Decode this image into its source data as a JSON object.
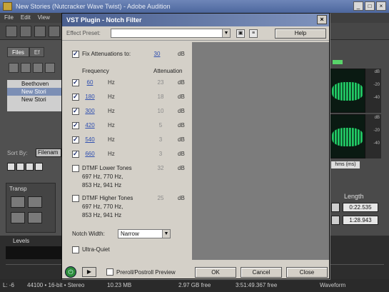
{
  "host": {
    "title": "New Stories (Nutcracker Wave Twist) - Adobe Audition",
    "menu": [
      "File",
      "Edit",
      "View"
    ],
    "window_buttons": [
      "_",
      "□",
      "×"
    ],
    "tabs": [
      "Files",
      "Ef"
    ],
    "files": [
      "Beethoven",
      "New Stori",
      "New Stori"
    ],
    "sort_label": "Sort By:",
    "sort_value": "Filenam",
    "transport_label": "Transp",
    "levels_label": "Levels",
    "hms": "hms (ms)",
    "length_label": "Length",
    "length_values": [
      "0:22.535",
      "1:28.943"
    ],
    "db_ticks": [
      "dB",
      "-20",
      "-40",
      "dB"
    ],
    "status": {
      "left": "L: -6",
      "format": "44100 • 16-bit • Stereo",
      "size": "10.23 MB",
      "free": "2.97 GB free",
      "time_free": "3:51:49.367 free",
      "view": "Waveform"
    }
  },
  "dialog": {
    "title": "VST Plugin - Notch Filter",
    "close": "×",
    "preset_label": "Effect Preset:",
    "preset_value": "",
    "help_label": "Help",
    "fix_label": "Fix Attenuations to:",
    "fix_value": "30",
    "fix_unit": "dB",
    "fix_checked": true,
    "col_frequency": "Frequency",
    "col_attenuation": "Attenuation",
    "notches": [
      {
        "checked": true,
        "freq": "60",
        "unit": "Hz",
        "atten": "23",
        "atten_unit": "dB"
      },
      {
        "checked": true,
        "freq": "180",
        "unit": "Hz",
        "atten": "18",
        "atten_unit": "dB"
      },
      {
        "checked": true,
        "freq": "300",
        "unit": "Hz",
        "atten": "10",
        "atten_unit": "dB"
      },
      {
        "checked": true,
        "freq": "420",
        "unit": "Hz",
        "atten": "5",
        "atten_unit": "dB"
      },
      {
        "checked": true,
        "freq": "540",
        "unit": "Hz",
        "atten": "3",
        "atten_unit": "dB"
      },
      {
        "checked": true,
        "freq": "660",
        "unit": "Hz",
        "atten": "3",
        "atten_unit": "dB"
      }
    ],
    "dtmf_lower": {
      "checked": false,
      "label": "DTMF Lower Tones",
      "value": "32",
      "unit": "dB",
      "lines": [
        "697 Hz, 770 Hz,",
        "853 Hz, 941 Hz"
      ]
    },
    "dtmf_higher": {
      "checked": false,
      "label": "DTMF Higher Tones",
      "value": "25",
      "unit": "dB",
      "lines": [
        "697 Hz, 770 Hz,",
        "853 Hz, 941 Hz"
      ]
    },
    "notch_width_label": "Notch Width:",
    "notch_width_value": "Narrow",
    "ultra_quiet_label": "Ultra-Quiet",
    "ultra_quiet_checked": false,
    "preroll_label": "Preroll/Postroll Preview",
    "ok": "OK",
    "cancel": "Cancel",
    "close_button": "Close"
  },
  "colors": {
    "dialog_bg": "#d4d0c8",
    "title_bar": "#4a5f8f",
    "value_blue": "#2f4fb0",
    "power_green": "#2c8a3a",
    "wave_green": "#25c866"
  }
}
